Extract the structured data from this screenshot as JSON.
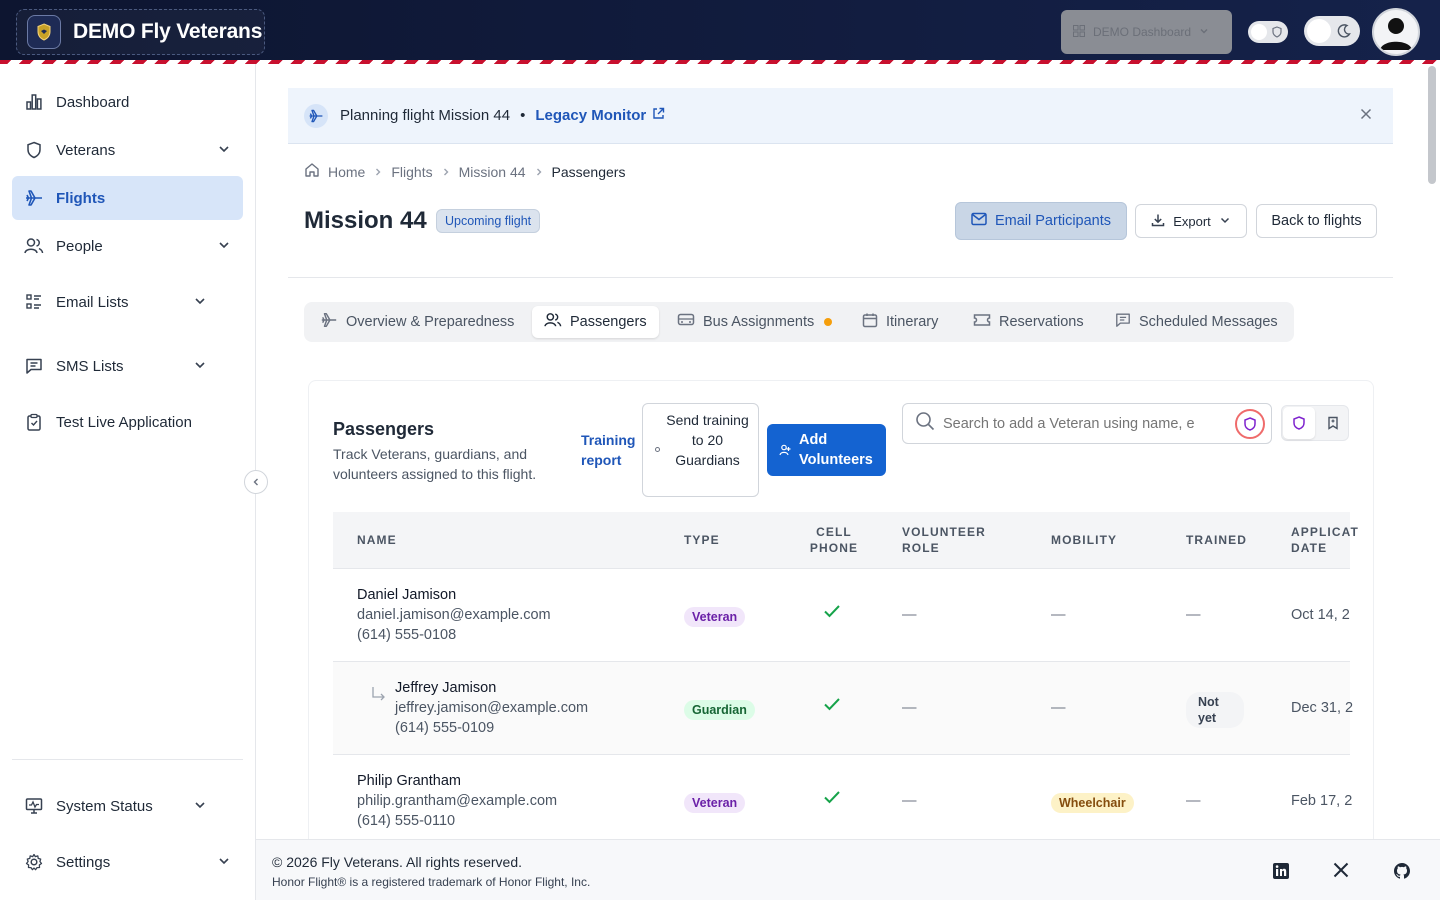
{
  "app": {
    "title": "DEMO Fly Veterans",
    "demo_dashboard_label": "DEMO Dashboard"
  },
  "sidebar": {
    "items": [
      {
        "label": "Dashboard",
        "icon": "chart-bar-icon"
      },
      {
        "label": "Veterans",
        "icon": "shield-icon"
      },
      {
        "label": "Flights",
        "icon": "plane-icon"
      },
      {
        "label": "People",
        "icon": "users-icon"
      },
      {
        "label": "Email Lists",
        "icon": "list-icon"
      },
      {
        "label": "SMS Lists",
        "icon": "message-icon"
      },
      {
        "label": "Test Live Application",
        "icon": "clipboard-icon"
      },
      {
        "label": "System Status",
        "icon": "monitor-icon"
      },
      {
        "label": "Settings",
        "icon": "gear-icon"
      }
    ]
  },
  "banner": {
    "text": "Planning flight Mission 44",
    "dot": "•",
    "link": "Legacy Monitor"
  },
  "breadcrumb": [
    "Home",
    "Flights",
    "Mission 44",
    "Passengers"
  ],
  "page": {
    "title": "Mission 44",
    "status": "Upcoming flight",
    "email_btn": "Email Participants",
    "export_btn": "Export",
    "back_btn": "Back to flights"
  },
  "tabs": [
    {
      "label": "Overview & Preparedness"
    },
    {
      "label": "Passengers"
    },
    {
      "label": "Bus Assignments"
    },
    {
      "label": "Itinerary"
    },
    {
      "label": "Reservations"
    },
    {
      "label": "Scheduled Messages"
    }
  ],
  "passengers": {
    "title": "Passengers",
    "description": "Track Veterans, guardians, and volunteers assigned to this flight.",
    "training_link": "Training report",
    "send_training": "Send training to 20 Guardians",
    "add_volunteers": "Add Volunteers",
    "search_placeholder": "Search to add a Veteran using name, e",
    "columns": [
      "Name",
      "Type",
      "Cell phone",
      "Volunteer role",
      "Mobility",
      "Trained",
      "Applicat date"
    ],
    "rows": [
      {
        "name": "Daniel Jamison",
        "email": "daniel.jamison@example.com",
        "phone": "(614) 555-0108",
        "type": "Veteran",
        "volunteer_role": "—",
        "mobility": "—",
        "trained": "—",
        "date": "Oct 14, 2"
      },
      {
        "name": "Jeffrey Jamison",
        "email": "jeffrey.jamison@example.com",
        "phone": "(614) 555-0109",
        "type": "Guardian",
        "volunteer_role": "—",
        "mobility": "—",
        "trained": "Not yet",
        "date": "Dec 31, 2"
      },
      {
        "name": "Philip Grantham",
        "email": "philip.grantham@example.com",
        "phone": "(614) 555-0110",
        "type": "Veteran",
        "volunteer_role": "—",
        "mobility": "Wheelchair",
        "trained": "—",
        "date": "Feb 17, 2"
      }
    ]
  },
  "footer": {
    "copyright": "© 2026 Fly Veterans. All rights reserved.",
    "trademark": "Honor Flight® is a registered trademark of Honor Flight, Inc."
  },
  "colors": {
    "accent": "#1f56b8",
    "topbar": "#0d1530",
    "stripe_red": "#c8102e",
    "primary_button": "#1463d1"
  }
}
